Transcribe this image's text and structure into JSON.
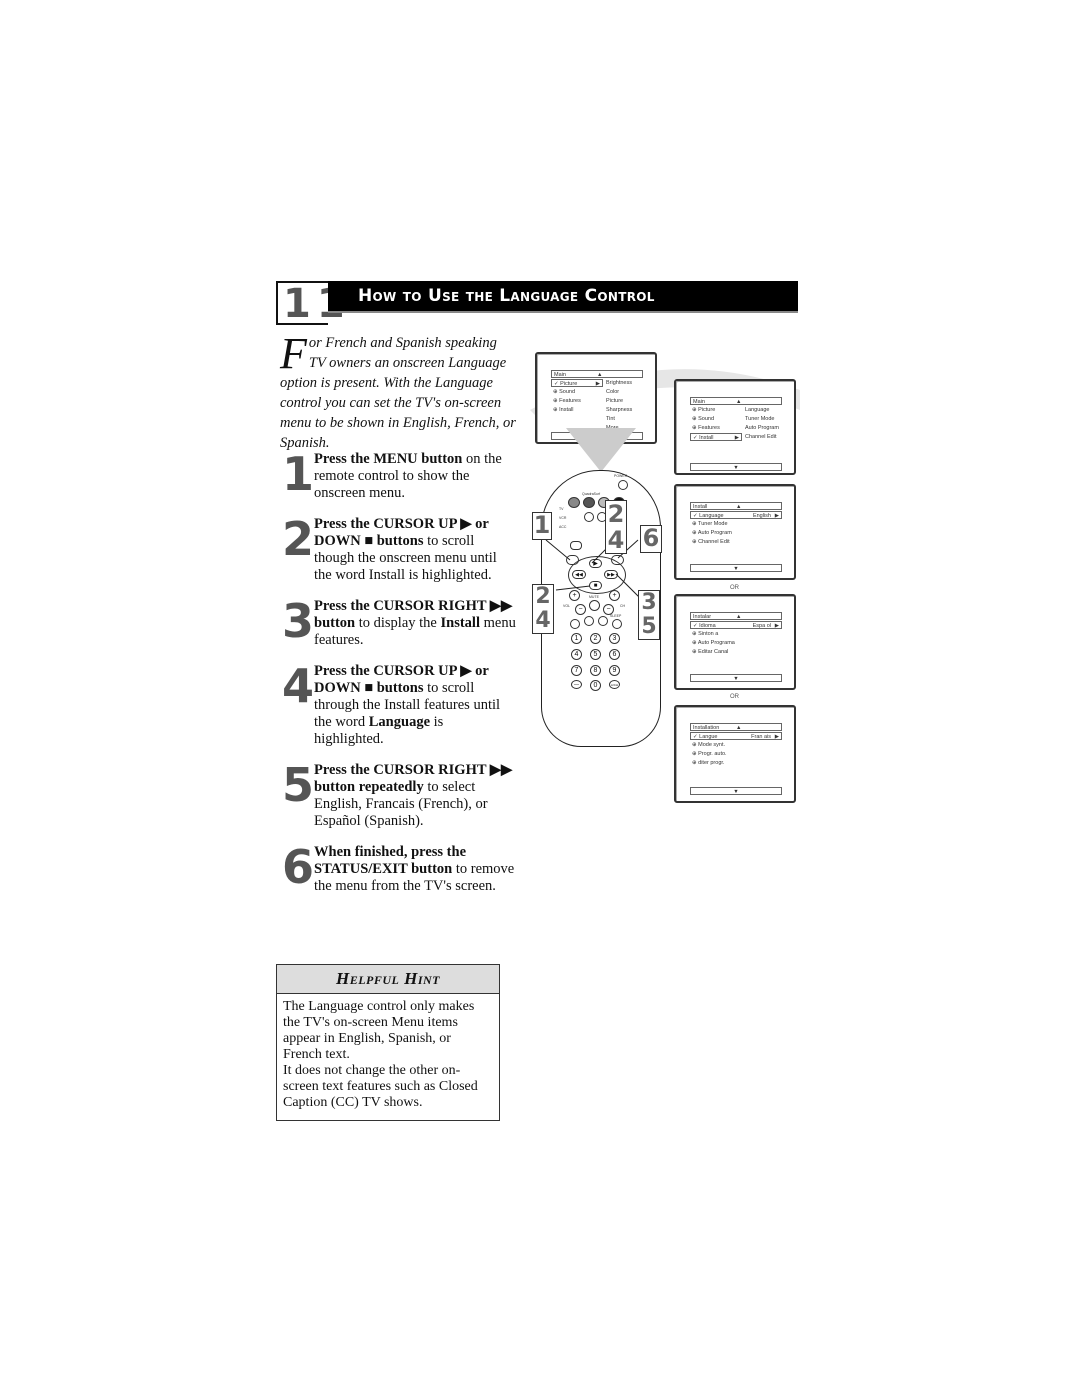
{
  "header": {
    "chapter_number": "11",
    "title": "How to Use the Language Control"
  },
  "intro": {
    "dropcap": "F",
    "text": "or French and Spanish speaking TV owners an onscreen Language option is present. With the Language control you can set the TV's on-screen menu to be shown in English, French, or Spanish."
  },
  "steps": [
    {
      "number": "1",
      "bold": "Press the MENU button",
      "rest": " on the remote control to show the onscreen menu."
    },
    {
      "number": "2",
      "bold": "Press the CURSOR UP ▶ or DOWN ■ buttons",
      "rest": " to scroll though the onscreen menu until the word Install is highlighted."
    },
    {
      "number": "3",
      "bold1": "Press the CURSOR RIGHT ▶▶ button",
      "mid": " to display the ",
      "bold2": "Install",
      "rest": " menu features."
    },
    {
      "number": "4",
      "bold1": "Press the CURSOR UP ▶ or DOWN ■ buttons",
      "mid": " to scroll through the Install features until the word ",
      "bold2": "Language",
      "rest": " is highlighted."
    },
    {
      "number": "5",
      "bold": "Press the CURSOR RIGHT ▶▶ button repeatedly",
      "rest": " to select English, Francais (French), or Español (Spanish)."
    },
    {
      "number": "6",
      "bold": "When finished, press the STATUS/EXIT button",
      "rest": " to remove the menu from the TV's screen."
    }
  ],
  "hint": {
    "title": "Helpful Hint",
    "line1": "The Language control only makes the TV's on-screen Menu items appear in English, Spanish, or French text.",
    "line2": "It does not change the other on-screen text features such as Closed Caption (CC) TV shows."
  },
  "screens": {
    "main_picture": {
      "head": "Main",
      "left": [
        "Picture",
        "Sound",
        "Features",
        "Install"
      ],
      "right": [
        "Brightness",
        "Color",
        "Picture",
        "Sharpness",
        "Tint",
        "More..."
      ]
    },
    "main_install": {
      "head": "Main",
      "left": [
        "Picture",
        "Sound",
        "Features",
        "Install"
      ],
      "right": [
        "Language",
        "Tuner Mode",
        "Auto Program",
        "Channel Edit"
      ]
    },
    "install_english": {
      "head": "Install",
      "selected": "Language",
      "value": "English",
      "items": [
        "Tuner Mode",
        "Auto Program",
        "Channel Edit"
      ]
    },
    "install_spanish": {
      "head": "Instalar",
      "selected": "Idioma",
      "value": "Espa ol",
      "items": [
        "Sinton a",
        "Auto Programa",
        "Editar Canal"
      ]
    },
    "install_french": {
      "head": "Installation",
      "selected": "Langue",
      "value": "Fran ais",
      "items": [
        "Mode synt.",
        "Progr. auto.",
        "diter progr."
      ]
    },
    "or_label": "OR"
  },
  "remote": {
    "power_label": "POWER",
    "quadrasurf_label": "QuadraSurf",
    "mode_labels": [
      "TV",
      "VCR",
      "ACC"
    ],
    "menu_label": "MENU",
    "exit_label": "EXIT",
    "status_label": "STATUS",
    "aspect_label": "A/CH",
    "vol_label": "VOL",
    "ch_label": "CH",
    "mute_label": "MUTE",
    "sleep_label": "SLEEP",
    "digits": [
      "1",
      "2",
      "3",
      "4",
      "5",
      "6",
      "7",
      "8",
      "9",
      "—",
      "0",
      "A/CH"
    ],
    "callouts": {
      "left_top": "1",
      "center_top": "2",
      "center_bottom": "4",
      "right_top": "6",
      "left_bottom_1": "2",
      "left_bottom_2": "4",
      "right_bottom_1": "3",
      "right_bottom_2": "5"
    }
  }
}
